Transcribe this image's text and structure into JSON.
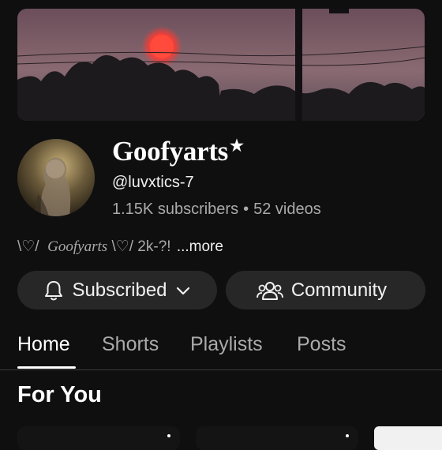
{
  "channel": {
    "name": "Goofyarts",
    "name_star": "★",
    "handle": "@luvxtics-7",
    "subscribers": "1.15K subscribers",
    "separator": "•",
    "videos": "52 videos"
  },
  "description": {
    "prefix": "\\♡/",
    "script_name": "Goofyarts",
    "suffix": "\\♡/ 2k-?!",
    "more": "...more"
  },
  "actions": {
    "subscribed_label": "Subscribed",
    "community_label": "Community"
  },
  "tabs": [
    {
      "label": "Home",
      "active": true
    },
    {
      "label": "Shorts"
    },
    {
      "label": "Playlists"
    },
    {
      "label": "Posts"
    }
  ],
  "section": {
    "title": "For You"
  },
  "icons": {
    "bell": "bell-icon",
    "chevron": "chevron-down-icon",
    "community": "community-people-icon",
    "kebab": "more-vert-icon"
  },
  "colors": {
    "background": "#0f0f0f",
    "button_bg": "#272727",
    "muted_text": "#aaaaaa",
    "primary_text": "#f1f1f1"
  }
}
